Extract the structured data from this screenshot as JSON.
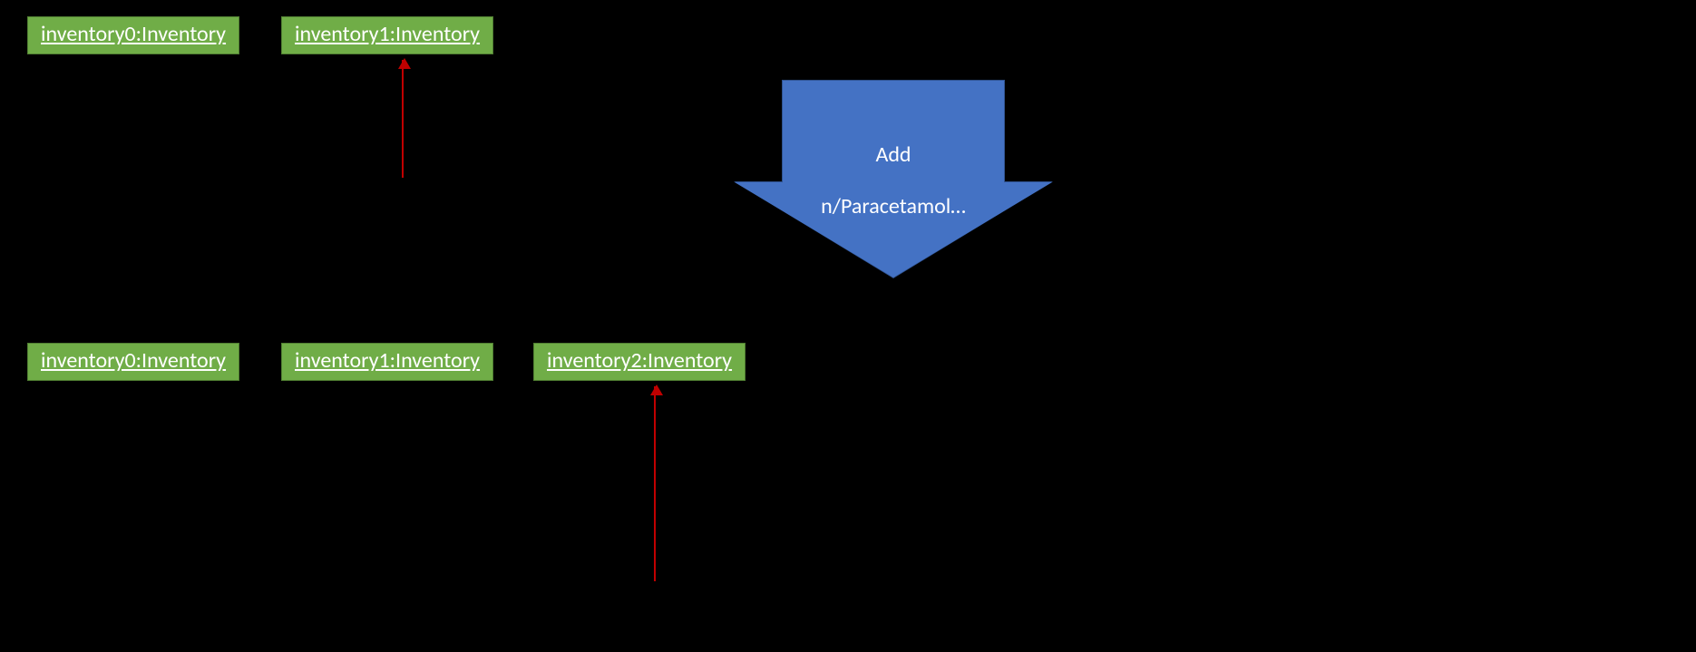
{
  "colors": {
    "box_fill": "#70AD47",
    "box_border": "#507E32",
    "arrow_fill": "#4472C4",
    "arrow_border": "#2F528F",
    "pointer": "#C00000",
    "background": "#000000",
    "text": "#FFFFFF"
  },
  "before": {
    "boxes": [
      {
        "label": "inventory0:Inventory"
      },
      {
        "label": "inventory1:Inventory"
      }
    ],
    "pointer_target_index": 1
  },
  "after": {
    "boxes": [
      {
        "label": "inventory0:Inventory"
      },
      {
        "label": "inventory1:Inventory"
      },
      {
        "label": "inventory2:Inventory"
      }
    ],
    "pointer_target_index": 2
  },
  "action_arrow": {
    "line1": "Add",
    "line2": "n/Paracetamol…"
  }
}
